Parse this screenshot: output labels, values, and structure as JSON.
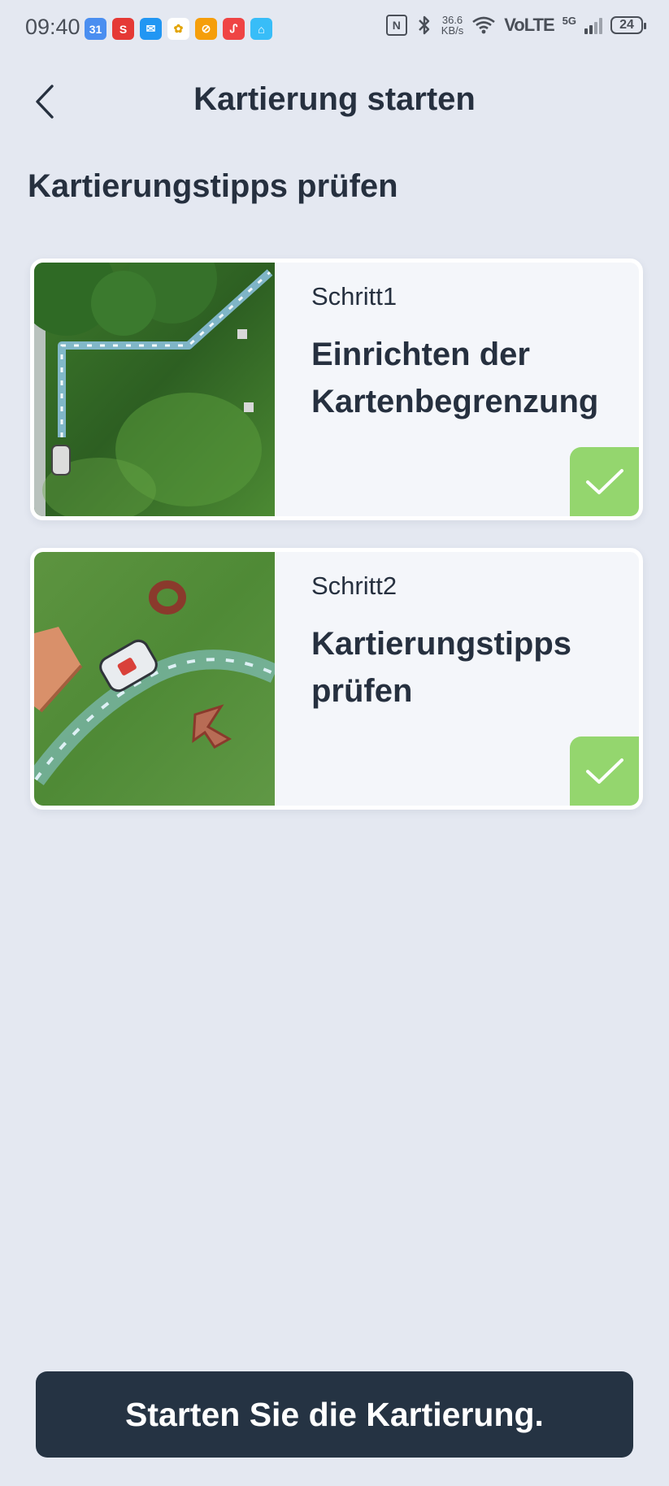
{
  "status_bar": {
    "time": "09:40",
    "app_icons": [
      {
        "name": "calendar-icon",
        "text": "31",
        "color": "#3b82f6"
      },
      {
        "name": "s-app-icon",
        "text": "S",
        "color": "#e53935"
      },
      {
        "name": "mail-icon",
        "text": "✉",
        "color": "#2196f3"
      },
      {
        "name": "photos-icon",
        "text": "✿",
        "color": "#ffffff"
      },
      {
        "name": "orange-app-icon",
        "text": "⊘",
        "color": "#f59e0b"
      },
      {
        "name": "red-app-icon",
        "text": "ᔑ",
        "color": "#ef4444"
      },
      {
        "name": "home-app-icon",
        "text": "⌂",
        "color": "#38bdf8"
      }
    ],
    "nfc": "N",
    "net_speed_value": "36.6",
    "net_speed_unit": "KB/s",
    "volte": "VoLTE",
    "network": "5G",
    "battery": "24"
  },
  "header": {
    "title": "Kartierung starten"
  },
  "section_title": "Kartierungstipps prüfen",
  "steps": [
    {
      "step_label": "Schritt1",
      "title": "Einrichten der Kartenbegrenzung",
      "completed": true
    },
    {
      "step_label": "Schritt2",
      "title": "Kartierungstipps prüfen",
      "completed": true
    }
  ],
  "cta": {
    "label": "Starten Sie die Kartierung."
  },
  "colors": {
    "background": "#e4e8f1",
    "text": "#26303f",
    "check_badge": "#94d66e",
    "cta_background": "#253343"
  }
}
